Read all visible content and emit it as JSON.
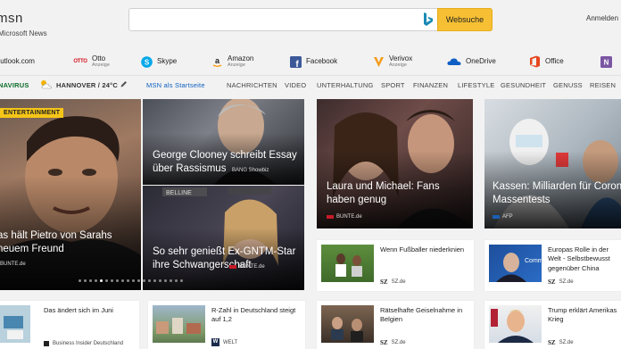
{
  "header": {
    "logo": "msn",
    "logo_sub": "Microsoft News",
    "search_value": "",
    "search_button": "Websuche",
    "signin": "Anmelden"
  },
  "quicklinks": [
    {
      "label": "Outlook.com",
      "sub": "",
      "icon": "outlook-icon"
    },
    {
      "label": "Otto",
      "sub": "Anzeige",
      "icon": "otto-logo-icon"
    },
    {
      "label": "Skype",
      "sub": "",
      "icon": "skype-icon"
    },
    {
      "label": "Amazon",
      "sub": "Anzeige",
      "icon": "amazon-icon"
    },
    {
      "label": "Facebook",
      "sub": "",
      "icon": "facebook-icon"
    },
    {
      "label": "Verivox",
      "sub": "Anzeige",
      "icon": "verivox-icon"
    },
    {
      "label": "OneDrive",
      "sub": "",
      "icon": "onedrive-icon"
    },
    {
      "label": "Office",
      "sub": "",
      "icon": "office-icon"
    },
    {
      "label": "",
      "sub": "",
      "icon": "onenote-icon"
    }
  ],
  "otto_logo_text": "OTTO",
  "nav": {
    "first": "NAVIRUS",
    "weather": "HANNOVER / 24°C",
    "startseite": "MSN als Startseite",
    "items": [
      "NACHRICHTEN",
      "VIDEO",
      "UNTERHALTUNG",
      "SPORT",
      "FINANZEN",
      "LIFESTYLE",
      "GESUNDHEIT",
      "GENUSS",
      "REISEN"
    ]
  },
  "hero": {
    "badge": "ENTERTAINMENT",
    "title": "as hält Pietro von Sarahs\nneuem Freund",
    "source": "BUNTE.de"
  },
  "story_top": {
    "title": "George Clooney schreibt Essay\nüber Rassismus",
    "source": "BANG Showbiz"
  },
  "story_bottom": {
    "title": "So sehr genießt Ex-GNTM-Star\nihre Schwangerschaft",
    "source": "BUNTE.de"
  },
  "story_mid": {
    "title": "Laura und Michael: Fans\nhaben genug",
    "source": "BUNTE.de"
  },
  "story_right": {
    "title": "Kassen: Milliarden für Coron\nMassentests",
    "source": "AFP"
  },
  "small_cards": [
    {
      "title": "Wenn Fußballer niederknien",
      "source": "SZ.de",
      "logo": "SZ"
    },
    {
      "title": "Europas Rolle in der Welt - Selbstbewusst gegenüber China",
      "source": "SZ.de",
      "logo": "SZ"
    },
    {
      "title": "Das ändert sich im Juni",
      "source": "Business Insider Deutschland",
      "logo": ""
    },
    {
      "title": "R-Zahl in Deutschland steigt auf 1,2",
      "source": "WELT",
      "logo": "W"
    },
    {
      "title": "Rätselhafte Geiselnahme in Belgien",
      "source": "SZ.de",
      "logo": "SZ"
    },
    {
      "title": "Trump erklärt Amerikas Krieg",
      "source": "SZ.de",
      "logo": "SZ"
    }
  ],
  "colors": {
    "accent_yellow": "#f7c034",
    "nav_green": "#0d6c2b",
    "link_blue": "#0d5fbf"
  }
}
